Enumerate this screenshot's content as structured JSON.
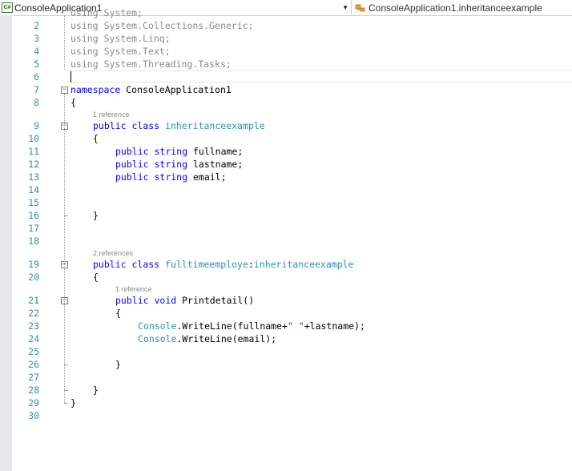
{
  "navbar": {
    "project_icon": "C#",
    "project_name": "ConsoleApplication1",
    "class_name": "ConsoleApplication1.inheritanceexample"
  },
  "lines": [
    {
      "n": "2"
    },
    {
      "n": "3"
    },
    {
      "n": "4"
    },
    {
      "n": "5"
    },
    {
      "n": "6"
    },
    {
      "n": "7"
    },
    {
      "n": "8"
    },
    {
      "n": "9"
    },
    {
      "n": "10"
    },
    {
      "n": "11"
    },
    {
      "n": "12"
    },
    {
      "n": "13"
    },
    {
      "n": "14"
    },
    {
      "n": "15"
    },
    {
      "n": "16"
    },
    {
      "n": "17"
    },
    {
      "n": "18"
    },
    {
      "n": "19"
    },
    {
      "n": "20"
    },
    {
      "n": "21"
    },
    {
      "n": "22"
    },
    {
      "n": "23"
    },
    {
      "n": "24"
    },
    {
      "n": "25"
    },
    {
      "n": "26"
    },
    {
      "n": "27"
    },
    {
      "n": "28"
    },
    {
      "n": "29"
    },
    {
      "n": "30"
    }
  ],
  "code": {
    "using": "using",
    "ns_collections": "System.Collections.Generic;",
    "ns_linq": "System.Linq;",
    "ns_text": "System.Text;",
    "ns_tasks": "System.Threading.Tasks;",
    "namespace_kw": "namespace",
    "namespace_name": "ConsoleApplication1",
    "open_brace": "{",
    "close_brace": "}",
    "public": "public",
    "class": "class",
    "string": "string",
    "void": "void",
    "class1_name": "inheritanceexample",
    "field1": "fullname;",
    "field2": "lastname;",
    "field3": "email;",
    "class2_name": "fulltimeemploye",
    "colon": ":",
    "base_class": "inheritanceexample",
    "method_name": "Printdetail()",
    "console": "Console",
    "writeline1_rest": ".WriteLine(fullname+",
    "writeline1_str": "\" \"",
    "writeline1_end": "+lastname);",
    "writeline2_rest": ".WriteLine(email);"
  },
  "codelens": {
    "ref1": "1 reference",
    "ref2": "2 references",
    "ref3": "1 reference"
  },
  "colors": {
    "keyword": "#0000ff",
    "type": "#2b91af",
    "line_number": "#2b91af",
    "string": "#a31515"
  }
}
